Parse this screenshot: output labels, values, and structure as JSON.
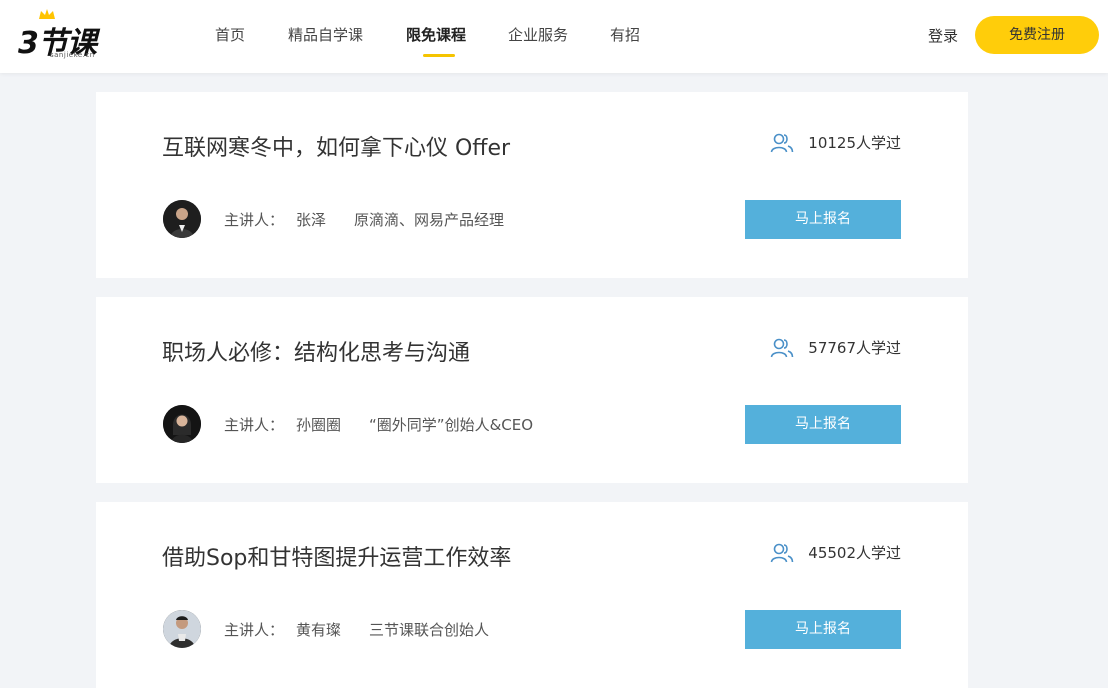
{
  "header": {
    "logo_text": "3节课",
    "logo_sub": "sanjieke.cn",
    "nav": [
      {
        "label": "首页"
      },
      {
        "label": "精品自学课"
      },
      {
        "label": "限免课程"
      },
      {
        "label": "企业服务"
      },
      {
        "label": "有招"
      }
    ],
    "active_nav": "限免课程",
    "login_label": "登录",
    "register_label": "免费注册"
  },
  "courses": [
    {
      "title": "互联网寒冬中，如何拿下心仪 Offer",
      "learners": "10125人学过",
      "speaker_label": "主讲人：",
      "speaker_name": "张泽",
      "speaker_role": "原滴滴、网易产品经理",
      "signup_label": "马上报名"
    },
    {
      "title": "职场人必修：结构化思考与沟通",
      "learners": "57767人学过",
      "speaker_label": "主讲人：",
      "speaker_name": "孙圈圈",
      "speaker_role": "“圈外同学”创始人&CEO",
      "signup_label": "马上报名"
    },
    {
      "title": "借助Sop和甘特图提升运营工作效率",
      "learners": "45502人学过",
      "speaker_label": "主讲人：",
      "speaker_name": "黄有璨",
      "speaker_role": "三节课联合创始人",
      "signup_label": "马上报名"
    }
  ],
  "colors": {
    "accent_yellow": "#ffcd0a",
    "signup_blue": "#54b0db",
    "icon_blue": "#4a90c8"
  },
  "icons": {
    "learners": "users-icon",
    "crown": "crown-icon"
  }
}
